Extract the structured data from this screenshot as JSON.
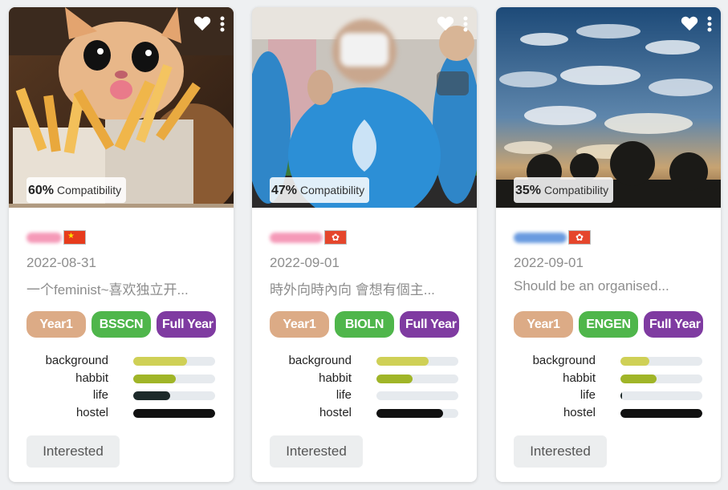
{
  "colors": {
    "chip_year": "#dcab86",
    "chip_major": "#4fb64b",
    "chip_duration": "#7f3ba1",
    "bar_background": "#cfd056",
    "bar_habbit": "#a0b528",
    "bar_life": "#1d2a2a",
    "bar_hostel": "#111111",
    "bar_track": "#e6eaee",
    "flag_china": "#e73b1c",
    "flag_hk": "#e5462c"
  },
  "cards": [
    {
      "photo_subject": "cat-with-french-fries",
      "compatibility_pct": "60%",
      "compatibility_label": "Compatibility",
      "name_blur_color": "#f59ab8",
      "flag": "china-flag",
      "date": "2022-08-31",
      "bio": "一个feminist~喜欢独立开...",
      "tags": [
        "Year1",
        "BSSCN",
        "Full Year"
      ],
      "bars": [
        {
          "label": "background",
          "value": 0.66
        },
        {
          "label": "habbit",
          "value": 0.52
        },
        {
          "label": "life",
          "value": 0.45
        },
        {
          "label": "hostel",
          "value": 1.0
        }
      ],
      "button_label": "Interested"
    },
    {
      "photo_subject": "blurred-student-in-blue-shirt",
      "compatibility_pct": "47%",
      "compatibility_label": "Compatibility",
      "name_blur_color": "#f59ab8",
      "flag": "hong-kong-flag",
      "date": "2022-09-01",
      "bio": "時外向時內向 會想有個主...",
      "tags": [
        "Year1",
        "BIOLN",
        "Full Year"
      ],
      "bars": [
        {
          "label": "background",
          "value": 0.64
        },
        {
          "label": "habbit",
          "value": 0.44
        },
        {
          "label": "life",
          "value": 0.0
        },
        {
          "label": "hostel",
          "value": 0.81
        }
      ],
      "button_label": "Interested"
    },
    {
      "photo_subject": "cloudy-sky-with-trees",
      "compatibility_pct": "35%",
      "compatibility_label": "Compatibility",
      "name_blur_color": "#6a9be0",
      "flag": "hong-kong-flag",
      "date": "2022-09-01",
      "bio": "Should be an organised...",
      "tags": [
        "Year1",
        "ENGEN",
        "Full Year"
      ],
      "bars": [
        {
          "label": "background",
          "value": 0.35
        },
        {
          "label": "habbit",
          "value": 0.44
        },
        {
          "label": "life",
          "value": 0.02
        },
        {
          "label": "hostel",
          "value": 1.0
        }
      ],
      "button_label": "Interested"
    }
  ]
}
